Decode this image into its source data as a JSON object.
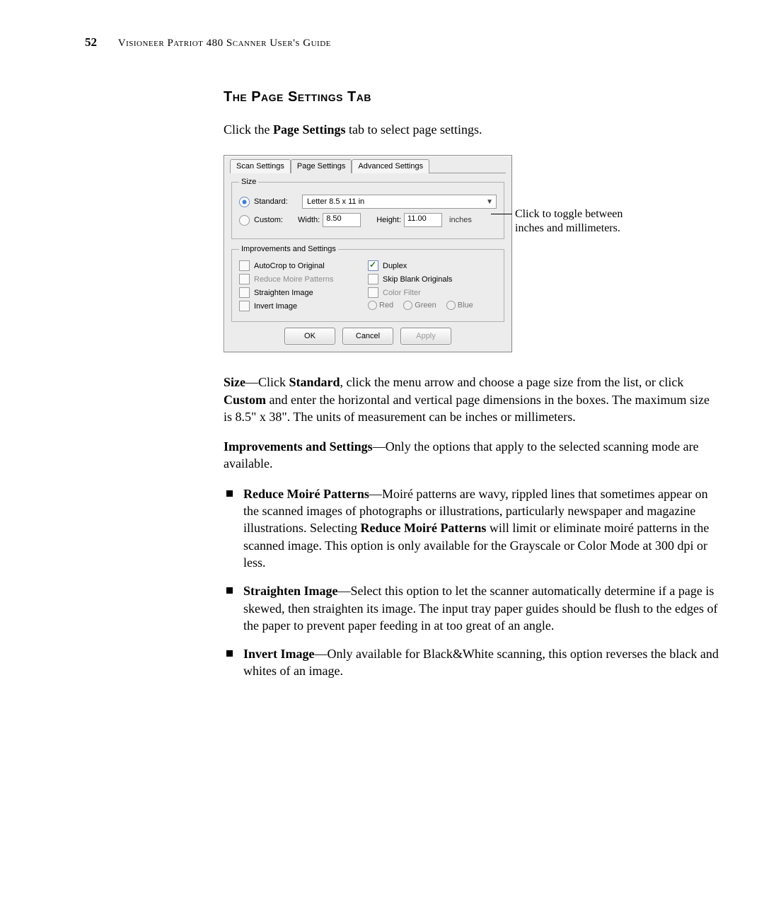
{
  "header": {
    "page_number": "52",
    "title": "Visioneer Patriot 480 Scanner User's Guide"
  },
  "section_title": "The Page Settings Tab",
  "intro_pre": "Click the ",
  "intro_b": "Page Settings",
  "intro_post": " tab to select page settings.",
  "annotation": "Click to toggle between inches and millimeters.",
  "dialog": {
    "tabs": {
      "scan": "Scan Settings",
      "page": "Page Settings",
      "adv": "Advanced Settings"
    },
    "size_group": "Size",
    "standard_label": "Standard:",
    "standard_value": "Letter 8.5 x 11 in",
    "custom_label": "Custom:",
    "width_label": "Width:",
    "width_value": "8.50",
    "height_label": "Height:",
    "height_value": "11.00",
    "units": "inches",
    "improve_group": "Improvements and Settings",
    "autocrop": "AutoCrop to Original",
    "moire": "Reduce Moire Patterns",
    "straighten": "Straighten Image",
    "invert": "Invert Image",
    "duplex": "Duplex",
    "skip_blank": "Skip Blank Originals",
    "color_filter": "Color Filter",
    "red": "Red",
    "green": "Green",
    "blue": "Blue",
    "ok": "OK",
    "cancel": "Cancel",
    "apply": "Apply"
  },
  "p_size": {
    "t1": "Size",
    "d1": "—Click ",
    "t2": "Standard",
    "d2": ", click the menu arrow and choose a page size from the list, or click ",
    "t3": "Custom",
    "d3": " and enter the horizontal and vertical page dimensions in the boxes. The maximum size is 8.5\" x 38\". The units of measurement can be inches or millimeters."
  },
  "p_improve": {
    "t1": "Improvements and Settings",
    "d1": "—Only the options that apply to the selected scanning mode are available."
  },
  "bullet1": {
    "t1": "Reduce Moiré Patterns",
    "d1": "—Moiré patterns are wavy, rippled lines that sometimes appear on the scanned images of photographs or illustrations, particularly newspaper and magazine illustrations. Selecting ",
    "t2": "Reduce Moiré Patterns",
    "d2": " will limit or eliminate moiré patterns in the scanned image. This option is only available for the Grayscale or Color Mode at 300 dpi or less."
  },
  "bullet2": {
    "t1": "Straighten Image",
    "d1": "—Select this option to let the scanner automatically determine if a page is skewed, then straighten its image. The input tray paper guides should be flush to the edges of the paper to prevent paper feeding in at too great of an angle."
  },
  "bullet3": {
    "t1": "Invert Image",
    "d1": "—Only available for Black&White scanning, this option reverses the black and whites of an image."
  }
}
